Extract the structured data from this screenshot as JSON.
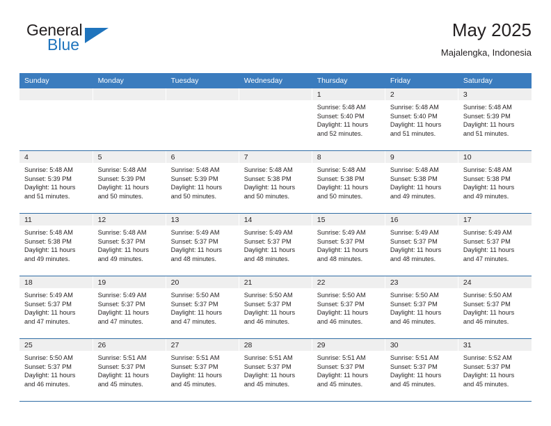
{
  "brand": {
    "name_top": "General",
    "name_bottom": "Blue",
    "flag_icon": "blue-triangle-flag-icon",
    "accent_color": "#1f74bd"
  },
  "header": {
    "title": "May 2025",
    "subtitle": "Majalengka, Indonesia"
  },
  "colors": {
    "header_row_bg": "#3b7cbe",
    "daynum_bg": "#efefef",
    "row_divider": "#2e6ca4",
    "text": "#231f20"
  },
  "calendar": {
    "weekday_headers": [
      "Sunday",
      "Monday",
      "Tuesday",
      "Wednesday",
      "Thursday",
      "Friday",
      "Saturday"
    ],
    "weeks": [
      [
        {
          "day": "",
          "lines": []
        },
        {
          "day": "",
          "lines": []
        },
        {
          "day": "",
          "lines": []
        },
        {
          "day": "",
          "lines": []
        },
        {
          "day": "1",
          "lines": [
            "Sunrise: 5:48 AM",
            "Sunset: 5:40 PM",
            "Daylight: 11 hours",
            "and 52 minutes."
          ]
        },
        {
          "day": "2",
          "lines": [
            "Sunrise: 5:48 AM",
            "Sunset: 5:40 PM",
            "Daylight: 11 hours",
            "and 51 minutes."
          ]
        },
        {
          "day": "3",
          "lines": [
            "Sunrise: 5:48 AM",
            "Sunset: 5:39 PM",
            "Daylight: 11 hours",
            "and 51 minutes."
          ]
        }
      ],
      [
        {
          "day": "4",
          "lines": [
            "Sunrise: 5:48 AM",
            "Sunset: 5:39 PM",
            "Daylight: 11 hours",
            "and 51 minutes."
          ]
        },
        {
          "day": "5",
          "lines": [
            "Sunrise: 5:48 AM",
            "Sunset: 5:39 PM",
            "Daylight: 11 hours",
            "and 50 minutes."
          ]
        },
        {
          "day": "6",
          "lines": [
            "Sunrise: 5:48 AM",
            "Sunset: 5:39 PM",
            "Daylight: 11 hours",
            "and 50 minutes."
          ]
        },
        {
          "day": "7",
          "lines": [
            "Sunrise: 5:48 AM",
            "Sunset: 5:38 PM",
            "Daylight: 11 hours",
            "and 50 minutes."
          ]
        },
        {
          "day": "8",
          "lines": [
            "Sunrise: 5:48 AM",
            "Sunset: 5:38 PM",
            "Daylight: 11 hours",
            "and 50 minutes."
          ]
        },
        {
          "day": "9",
          "lines": [
            "Sunrise: 5:48 AM",
            "Sunset: 5:38 PM",
            "Daylight: 11 hours",
            "and 49 minutes."
          ]
        },
        {
          "day": "10",
          "lines": [
            "Sunrise: 5:48 AM",
            "Sunset: 5:38 PM",
            "Daylight: 11 hours",
            "and 49 minutes."
          ]
        }
      ],
      [
        {
          "day": "11",
          "lines": [
            "Sunrise: 5:48 AM",
            "Sunset: 5:38 PM",
            "Daylight: 11 hours",
            "and 49 minutes."
          ]
        },
        {
          "day": "12",
          "lines": [
            "Sunrise: 5:48 AM",
            "Sunset: 5:37 PM",
            "Daylight: 11 hours",
            "and 49 minutes."
          ]
        },
        {
          "day": "13",
          "lines": [
            "Sunrise: 5:49 AM",
            "Sunset: 5:37 PM",
            "Daylight: 11 hours",
            "and 48 minutes."
          ]
        },
        {
          "day": "14",
          "lines": [
            "Sunrise: 5:49 AM",
            "Sunset: 5:37 PM",
            "Daylight: 11 hours",
            "and 48 minutes."
          ]
        },
        {
          "day": "15",
          "lines": [
            "Sunrise: 5:49 AM",
            "Sunset: 5:37 PM",
            "Daylight: 11 hours",
            "and 48 minutes."
          ]
        },
        {
          "day": "16",
          "lines": [
            "Sunrise: 5:49 AM",
            "Sunset: 5:37 PM",
            "Daylight: 11 hours",
            "and 48 minutes."
          ]
        },
        {
          "day": "17",
          "lines": [
            "Sunrise: 5:49 AM",
            "Sunset: 5:37 PM",
            "Daylight: 11 hours",
            "and 47 minutes."
          ]
        }
      ],
      [
        {
          "day": "18",
          "lines": [
            "Sunrise: 5:49 AM",
            "Sunset: 5:37 PM",
            "Daylight: 11 hours",
            "and 47 minutes."
          ]
        },
        {
          "day": "19",
          "lines": [
            "Sunrise: 5:49 AM",
            "Sunset: 5:37 PM",
            "Daylight: 11 hours",
            "and 47 minutes."
          ]
        },
        {
          "day": "20",
          "lines": [
            "Sunrise: 5:50 AM",
            "Sunset: 5:37 PM",
            "Daylight: 11 hours",
            "and 47 minutes."
          ]
        },
        {
          "day": "21",
          "lines": [
            "Sunrise: 5:50 AM",
            "Sunset: 5:37 PM",
            "Daylight: 11 hours",
            "and 46 minutes."
          ]
        },
        {
          "day": "22",
          "lines": [
            "Sunrise: 5:50 AM",
            "Sunset: 5:37 PM",
            "Daylight: 11 hours",
            "and 46 minutes."
          ]
        },
        {
          "day": "23",
          "lines": [
            "Sunrise: 5:50 AM",
            "Sunset: 5:37 PM",
            "Daylight: 11 hours",
            "and 46 minutes."
          ]
        },
        {
          "day": "24",
          "lines": [
            "Sunrise: 5:50 AM",
            "Sunset: 5:37 PM",
            "Daylight: 11 hours",
            "and 46 minutes."
          ]
        }
      ],
      [
        {
          "day": "25",
          "lines": [
            "Sunrise: 5:50 AM",
            "Sunset: 5:37 PM",
            "Daylight: 11 hours",
            "and 46 minutes."
          ]
        },
        {
          "day": "26",
          "lines": [
            "Sunrise: 5:51 AM",
            "Sunset: 5:37 PM",
            "Daylight: 11 hours",
            "and 45 minutes."
          ]
        },
        {
          "day": "27",
          "lines": [
            "Sunrise: 5:51 AM",
            "Sunset: 5:37 PM",
            "Daylight: 11 hours",
            "and 45 minutes."
          ]
        },
        {
          "day": "28",
          "lines": [
            "Sunrise: 5:51 AM",
            "Sunset: 5:37 PM",
            "Daylight: 11 hours",
            "and 45 minutes."
          ]
        },
        {
          "day": "29",
          "lines": [
            "Sunrise: 5:51 AM",
            "Sunset: 5:37 PM",
            "Daylight: 11 hours",
            "and 45 minutes."
          ]
        },
        {
          "day": "30",
          "lines": [
            "Sunrise: 5:51 AM",
            "Sunset: 5:37 PM",
            "Daylight: 11 hours",
            "and 45 minutes."
          ]
        },
        {
          "day": "31",
          "lines": [
            "Sunrise: 5:52 AM",
            "Sunset: 5:37 PM",
            "Daylight: 11 hours",
            "and 45 minutes."
          ]
        }
      ]
    ]
  }
}
